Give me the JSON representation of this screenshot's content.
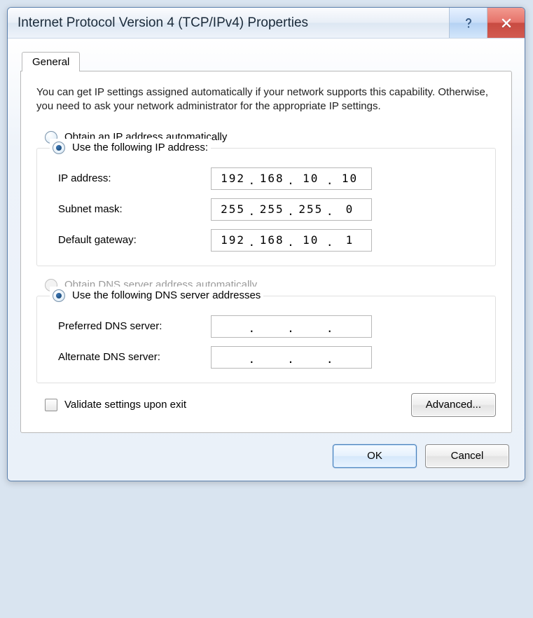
{
  "title": "Internet Protocol Version 4 (TCP/IPv4) Properties",
  "tab": {
    "general": "General"
  },
  "intro": "You can get IP settings assigned automatically if your network supports this capability. Otherwise, you need to ask your network administrator for the appropriate IP settings.",
  "ip_section": {
    "auto_label": "Obtain an IP address automatically",
    "auto_selected": false,
    "manual_label": "Use the following IP address:",
    "manual_selected": true,
    "fields": {
      "ip_label": "IP address:",
      "ip_value": [
        "192",
        "168",
        "10",
        "10"
      ],
      "mask_label": "Subnet mask:",
      "mask_value": [
        "255",
        "255",
        "255",
        "0"
      ],
      "gateway_label": "Default gateway:",
      "gateway_value": [
        "192",
        "168",
        "10",
        "1"
      ]
    }
  },
  "dns_section": {
    "auto_label": "Obtain DNS server address automatically",
    "auto_disabled": true,
    "manual_label": "Use the following DNS server addresses",
    "manual_selected": true,
    "fields": {
      "pref_label": "Preferred DNS server:",
      "pref_value": [
        "",
        "",
        "",
        ""
      ],
      "alt_label": "Alternate DNS server:",
      "alt_value": [
        "",
        "",
        "",
        ""
      ]
    }
  },
  "validate_label": "Validate settings upon exit",
  "buttons": {
    "advanced": "Advanced...",
    "ok": "OK",
    "cancel": "Cancel"
  }
}
